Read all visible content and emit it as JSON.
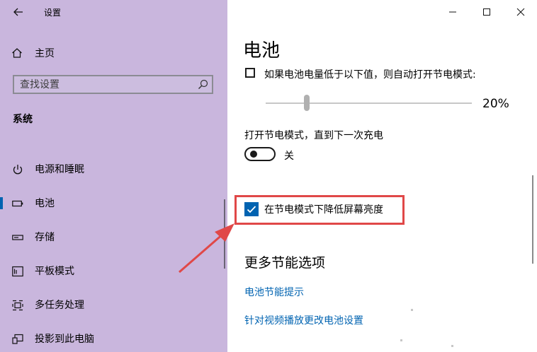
{
  "window": {
    "title": "设置"
  },
  "sidebar": {
    "home_label": "主页",
    "search_placeholder": "查找设置",
    "section_title": "系统",
    "items": [
      {
        "label": "电源和睡眠",
        "icon": "power-icon"
      },
      {
        "label": "电池",
        "icon": "battery-icon",
        "active": true
      },
      {
        "label": "存储",
        "icon": "storage-icon"
      },
      {
        "label": "平板模式",
        "icon": "tablet-mode-icon"
      },
      {
        "label": "多任务处理",
        "icon": "multitasking-icon"
      },
      {
        "label": "投影到此电脑",
        "icon": "project-icon"
      }
    ]
  },
  "main": {
    "title": "电池",
    "auto_saver_label": "如果电池电量低于以下值，则自动打开节电模式:",
    "auto_saver_checked": false,
    "threshold_value": "20%",
    "threshold_percent": 20,
    "toggle_caption": "打开节电模式，直到下一次充电",
    "toggle_state": "关",
    "toggle_on": false,
    "dim_label": "在节电模式下降低屏幕亮度",
    "dim_checked": true,
    "more_title": "更多节能选项",
    "links": [
      "电池节能提示",
      "针对视频播放更改电池设置"
    ]
  },
  "colors": {
    "sidebar_bg": "#c9b6dd",
    "accent": "#0063b1",
    "highlight": "#e04848"
  }
}
